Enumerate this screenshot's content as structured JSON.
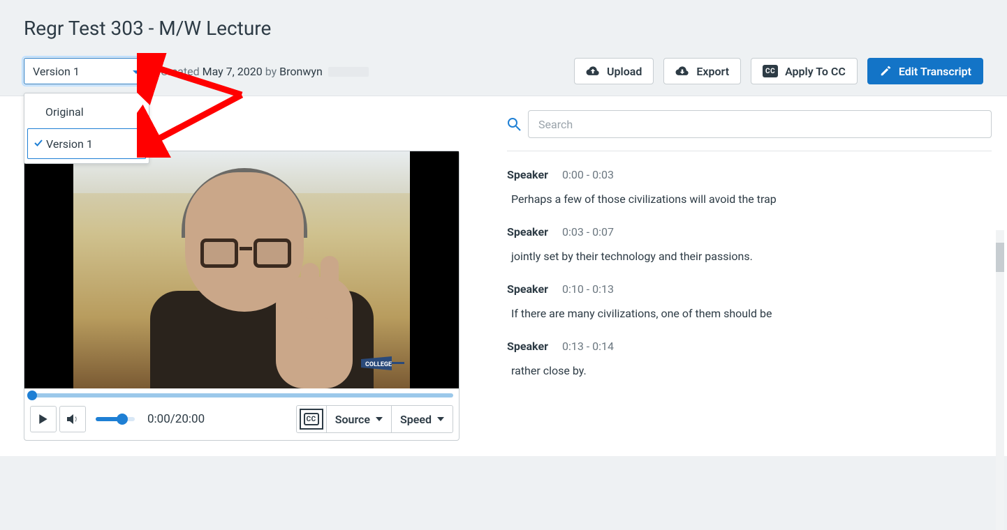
{
  "page": {
    "title": "Regr Test 303 - M/W Lecture"
  },
  "versionSelect": {
    "current": "Version 1",
    "options": [
      "Original",
      "Version 1"
    ],
    "selectedIndex": 1
  },
  "meta": {
    "createdLabel": "Created",
    "date": "May 7, 2020",
    "byLabel": "by",
    "author": "Bronwyn"
  },
  "buttons": {
    "upload": "Upload",
    "export": "Export",
    "applyCC": "Apply To CC",
    "edit": "Edit Transcript"
  },
  "player": {
    "currentTime": "0:00",
    "duration": "20:00",
    "ccLabel": "CC",
    "sourceLabel": "Source",
    "speedLabel": "Speed",
    "watermark": "COLLEGE"
  },
  "search": {
    "placeholder": "Search"
  },
  "transcript": [
    {
      "speaker": "Speaker",
      "time": "0:00 - 0:03",
      "text": "Perhaps a few of those civilizations will avoid the trap"
    },
    {
      "speaker": "Speaker",
      "time": "0:03 - 0:07",
      "text": "jointly set by their technology and their passions."
    },
    {
      "speaker": "Speaker",
      "time": "0:10 - 0:13",
      "text": "If there are many civilizations, one of them should be"
    },
    {
      "speaker": "Speaker",
      "time": "0:13 - 0:14",
      "text": "rather close by."
    }
  ]
}
